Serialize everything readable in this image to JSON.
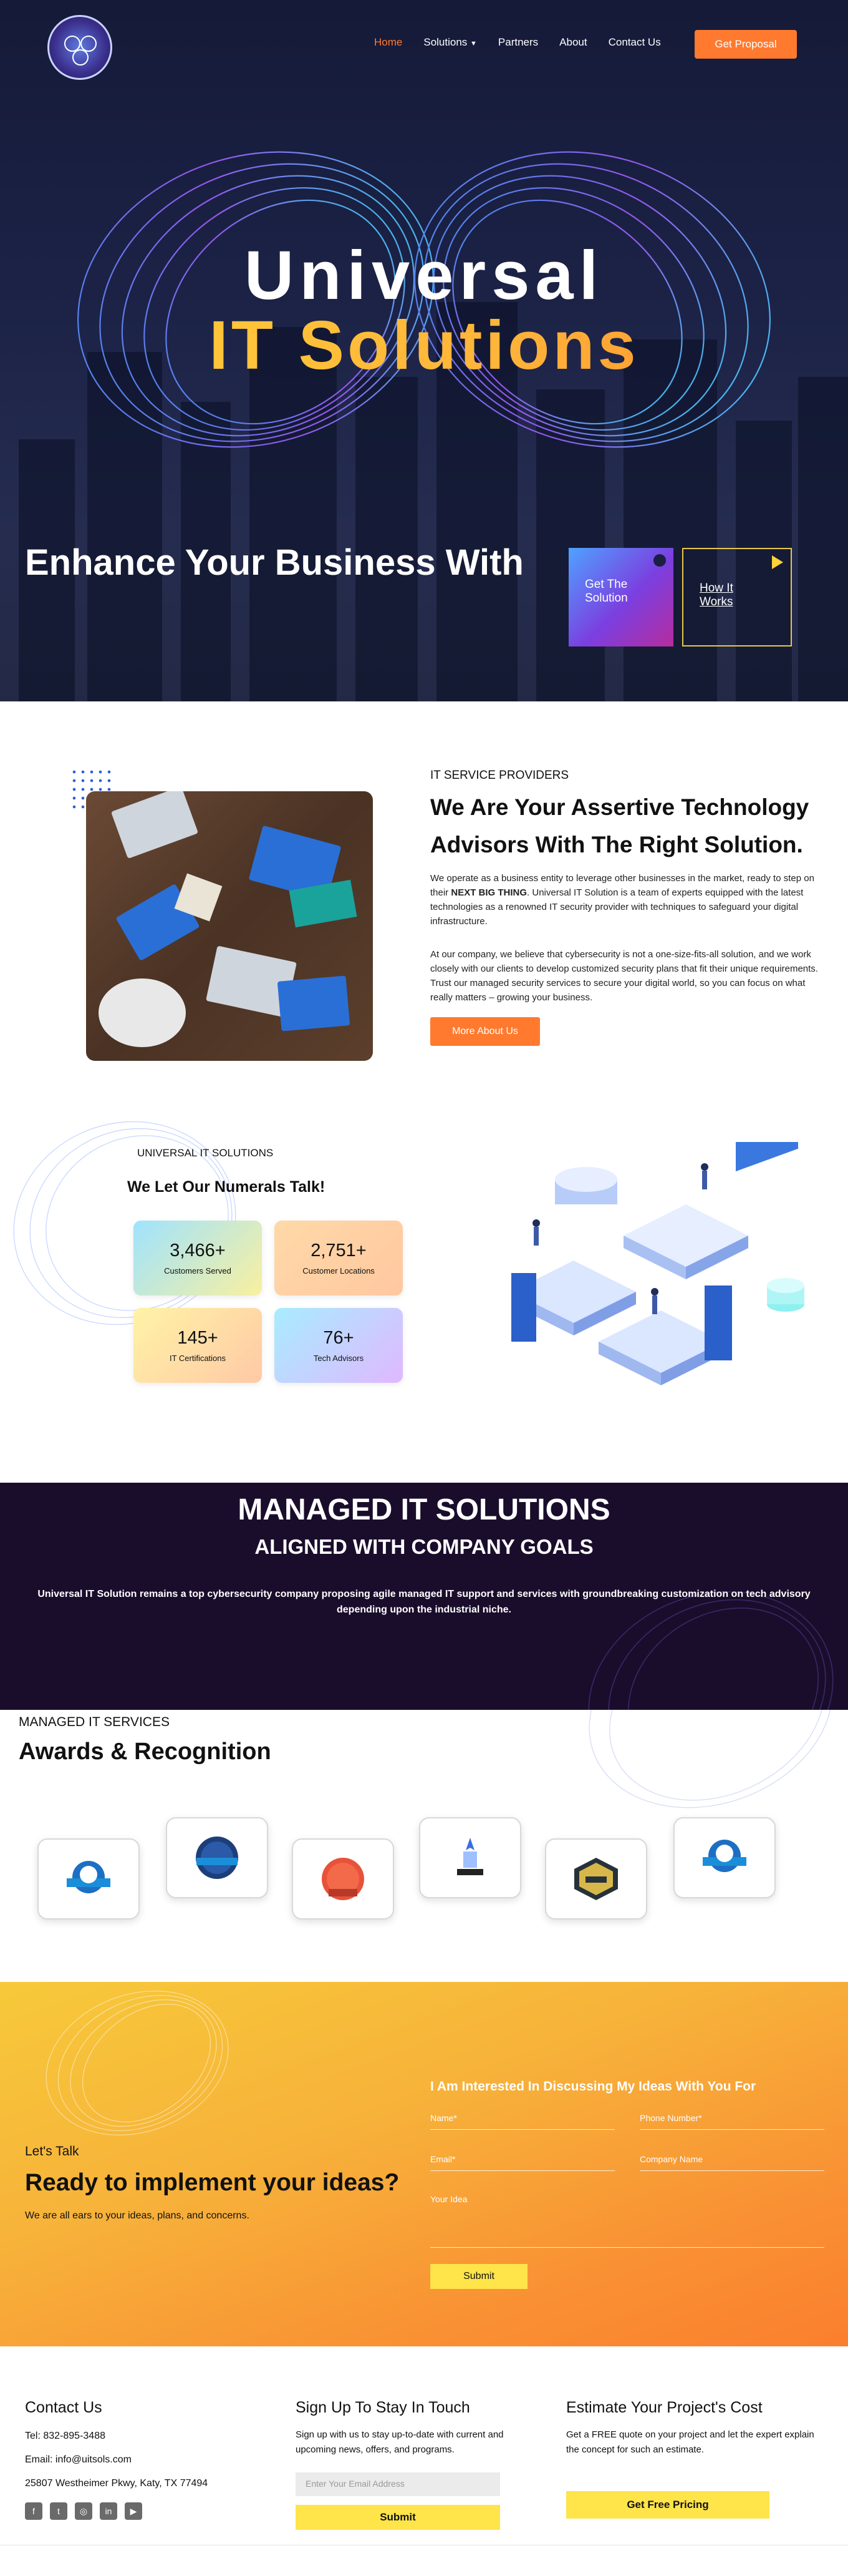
{
  "nav": {
    "items": [
      "Home",
      "Solutions",
      "Partners",
      "About",
      "Contact Us"
    ],
    "cta": "Get Proposal"
  },
  "hero": {
    "title_line1": "Universal",
    "title_line2": "IT Solutions",
    "subtitle": "Enhance Your Business With",
    "card1": "Get The Solution",
    "card2": "How It Works"
  },
  "about": {
    "label": "IT SERVICE PROVIDERS",
    "title": "We Are Your Assertive Technology Advisors With The Right Solution.",
    "p1_before": "We operate as a business entity to leverage other businesses in the market, ready to step on their ",
    "p1_bold": "NEXT BIG THING",
    "p1_after": ". Universal IT Solution is a team of experts equipped with the latest technologies as a renowned IT security provider with techniques to safeguard your digital infrastructure.",
    "p2": "At our company, we believe that cybersecurity is not a one-size-fits-all solution, and we work closely with our clients to develop customized security plans that fit their unique requirements. Trust our managed security services to secure your digital world, so you can focus on what really matters – growing your business.",
    "button": "More About Us"
  },
  "stats": {
    "label": "UNIVERSAL IT SOLUTIONS",
    "title": "We Let Our Numerals Talk!",
    "items": [
      {
        "value": "3,466+",
        "label": "Customers Served"
      },
      {
        "value": "2,751+",
        "label": "Customer Locations"
      },
      {
        "value": "145+",
        "label": "IT Certifications"
      },
      {
        "value": "76+",
        "label": "Tech Advisors"
      }
    ]
  },
  "managed": {
    "title": "MANAGED IT SOLUTIONS",
    "subtitle": "ALIGNED WITH COMPANY GOALS",
    "text": "Universal IT Solution remains a top cybersecurity company proposing agile managed IT support and services with groundbreaking customization on tech advisory depending upon the industrial niche."
  },
  "awards": {
    "label": "MANAGED IT SERVICES",
    "title": "Awards & Recognition"
  },
  "cta": {
    "small": "Let's Talk",
    "title": "Ready to implement your ideas?",
    "desc": "We are all ears to your ideas, plans, and concerns.",
    "form_title": "I Am Interested In Discussing My Ideas With You For",
    "name_placeholder": "Name*",
    "phone_placeholder": "Phone Number*",
    "email_placeholder": "Email*",
    "company_placeholder": "Company Name",
    "idea_placeholder": "Your Idea",
    "submit": "Submit"
  },
  "footer": {
    "contact_title": "Contact Us",
    "tel": "Tel: 832-895-3488",
    "email": "Email: info@uitsols.com",
    "address": "25807 Westheimer Pkwy, Katy, TX 77494",
    "signup_title": "Sign Up To Stay In Touch",
    "signup_text": "Sign up with us to stay up-to-date with current and upcoming news, offers, and programs.",
    "email_placeholder": "Enter Your Email Address",
    "submit": "Submit",
    "estimate_title": "Estimate Your Project's Cost",
    "estimate_text": "Get a FREE quote on your project and let the expert explain the concept for such an estimate.",
    "pricing_button": "Get Free Pricing"
  }
}
